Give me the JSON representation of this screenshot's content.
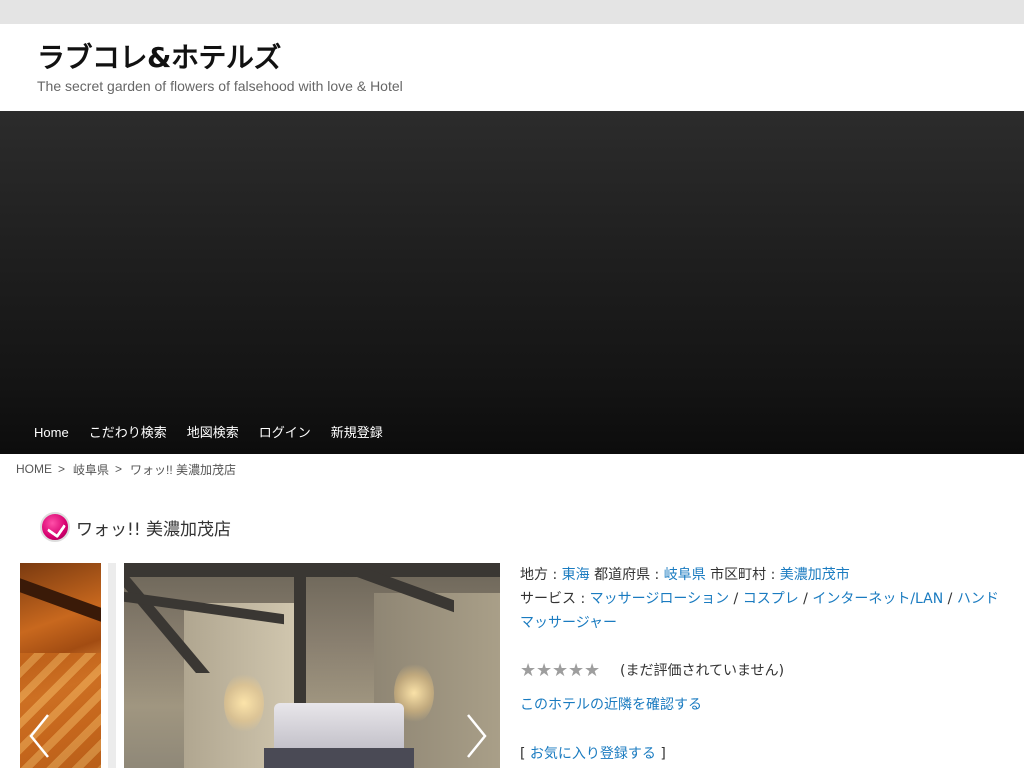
{
  "site": {
    "title": "ラブコレ&ホテルズ",
    "description": "The secret garden of flowers of falsehood with love & Hotel"
  },
  "nav": {
    "items": [
      "Home",
      "こだわり検索",
      "地図検索",
      "ログイン",
      "新規登録"
    ]
  },
  "breadcrumb": {
    "home": "HOME",
    "sep": ">",
    "prefecture": "岐阜県",
    "current": "ワォッ!! 美濃加茂店"
  },
  "hotel": {
    "name": "ワォッ!! 美濃加茂店",
    "region_label": "地方 : ",
    "region": "東海",
    "prefecture_label": " 都道府県 : ",
    "prefecture": "岐阜県",
    "city_label": " 市区町村 : ",
    "city": "美濃加茂市",
    "services_label": "サービス : ",
    "services": [
      "マッサージローション",
      "コスプレ",
      "インターネット/LAN",
      "ハンドマッサージャー"
    ],
    "service_sep": " / ",
    "rating_stars": 0,
    "rating_max": 5,
    "rating_text": "(まだ評価されていません)",
    "nearby_link": "このホテルの近隣を確認する",
    "fav_open": "[ ",
    "fav_link": "お気に入り登録する",
    "fav_close": " ]"
  },
  "colors": {
    "link": "#1a7bc0",
    "topbar": "#e4e4e4",
    "hero_dark": "#141414"
  }
}
